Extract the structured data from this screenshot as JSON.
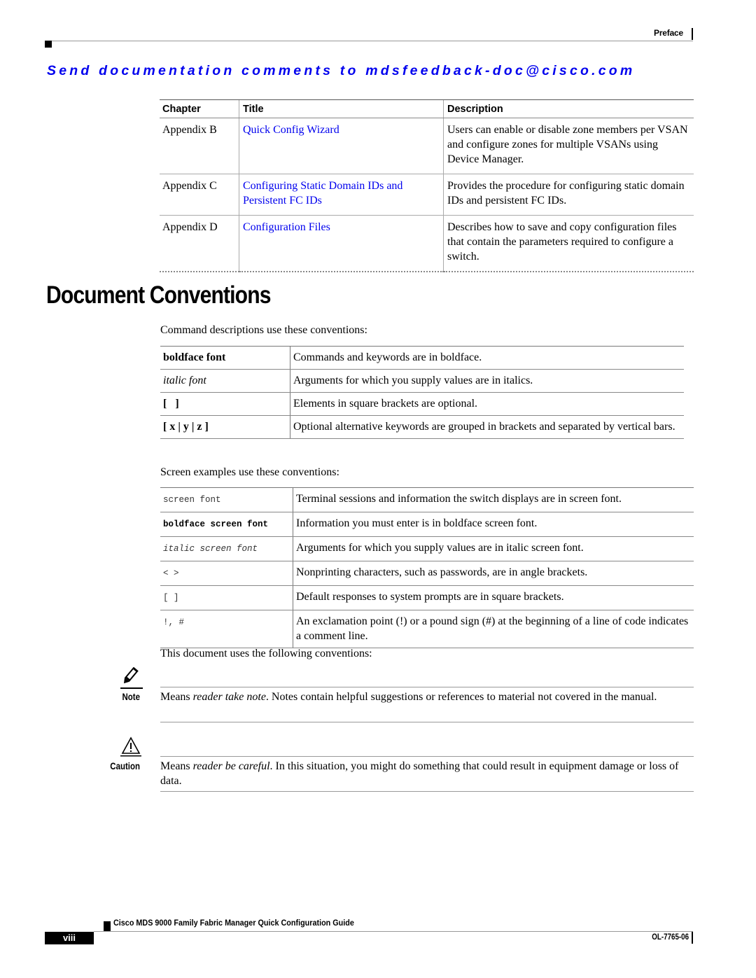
{
  "header": {
    "section_label": "Preface",
    "feedback_line": "Send documentation comments to mdsfeedback-doc@cisco.com"
  },
  "chapter_table": {
    "columns": [
      "Chapter",
      "Title",
      "Description"
    ],
    "rows": [
      {
        "chapter": "Appendix B",
        "title": "Quick Config Wizard",
        "description": "Users can enable or disable zone members per VSAN and configure zones for multiple VSANs using Device Manager."
      },
      {
        "chapter": "Appendix C",
        "title": "Configuring Static Domain IDs and Persistent FC IDs",
        "description": "Provides the procedure for configuring static domain IDs and persistent FC IDs."
      },
      {
        "chapter": "Appendix D",
        "title": "Configuration Files",
        "description": "Describes how to save and copy configuration files that contain the parameters required to configure a switch."
      }
    ],
    "link_color": "#0000ee"
  },
  "section": {
    "title": "Document Conventions",
    "command_intro": "Command descriptions use these conventions:",
    "command_conventions": [
      {
        "key": "boldface font",
        "style": "bold",
        "desc": "Commands and keywords are in boldface."
      },
      {
        "key": "italic font",
        "style": "italic",
        "desc": "Arguments for which you supply values are in italics."
      },
      {
        "key": "[   ]",
        "style": "bold",
        "desc": "Elements in square brackets are optional."
      },
      {
        "key": "[ x | y | z ]",
        "style": "bold",
        "desc": "Optional alternative keywords are grouped in brackets and separated by vertical bars."
      }
    ],
    "screen_intro": "Screen examples use these conventions:",
    "screen_conventions": [
      {
        "key": "screen font",
        "style": "mono",
        "desc": "Terminal sessions and information the switch displays are in screen font."
      },
      {
        "key": "boldface screen font",
        "style": "mono-bold",
        "desc": "Information you must enter is in boldface screen font."
      },
      {
        "key": "italic screen font",
        "style": "mono-italic",
        "desc": "Arguments for which you supply values are in italic screen font."
      },
      {
        "key": "< >",
        "style": "mono",
        "desc": "Nonprinting characters, such as passwords, are in angle brackets."
      },
      {
        "key": "[ ]",
        "style": "mono",
        "desc": "Default responses to system prompts are in square brackets."
      },
      {
        "key": "!, #",
        "style": "mono",
        "desc": "An exclamation point (!) or a pound sign (#) at the beginning of a line of code indicates a comment line."
      }
    ],
    "doc_intro": "This document uses the following conventions:",
    "note": {
      "label": "Note",
      "icon": "pencil-note-icon",
      "pre": "Means ",
      "emph": "reader take note",
      "post": ". Notes contain helpful suggestions or references to material not covered in the manual."
    },
    "caution": {
      "label": "Caution",
      "icon": "warning-triangle-icon",
      "pre": "Means ",
      "emph": "reader be careful",
      "post": ". In this situation, you might do something that could result in equipment damage or loss of data."
    }
  },
  "footer": {
    "guide_title": "Cisco MDS 9000 Family Fabric Manager Quick Configuration Guide",
    "page_number": "viii",
    "doc_number": "OL-7765-06"
  }
}
